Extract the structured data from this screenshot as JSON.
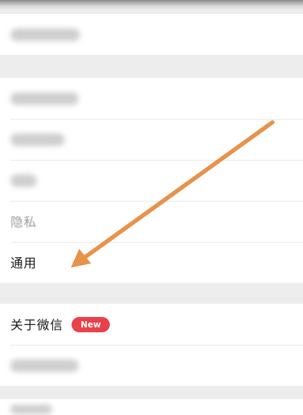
{
  "settings": {
    "privacy_label": "隐私",
    "general_label": "通用",
    "about_label": "关于微信",
    "about_badge": "New"
  },
  "annotation": {
    "arrow_color": "#e8924a",
    "arrow_target": "通用"
  }
}
